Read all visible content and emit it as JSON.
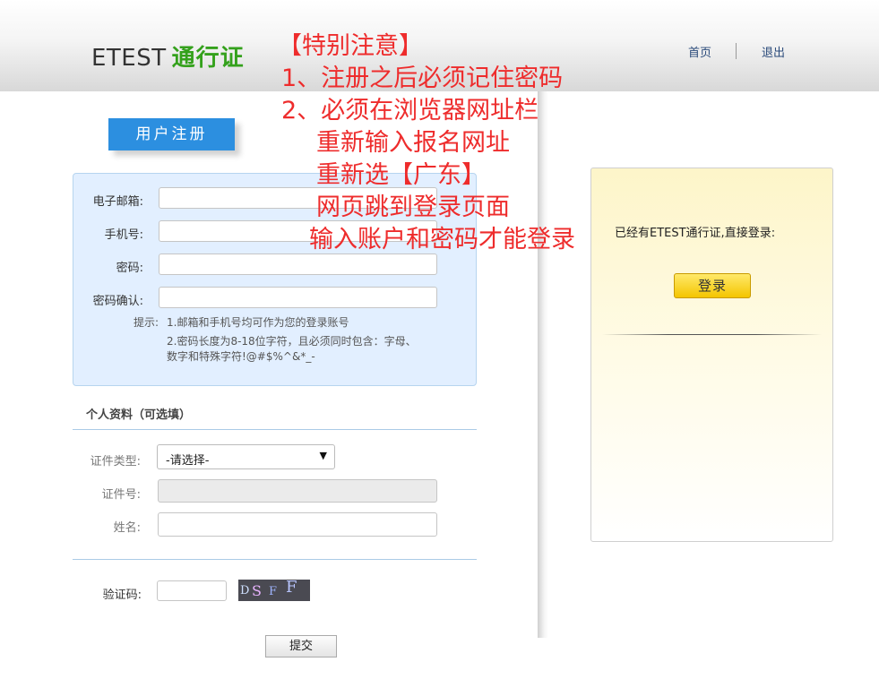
{
  "header": {
    "brand_name": "ETEST",
    "brand_suffix": "通行证",
    "nav_home": "首页",
    "nav_logout": "退出"
  },
  "notice": {
    "lines": [
      "【特别注意】",
      "1、注册之后必须记住密码",
      "2、必须在浏览器网址栏",
      "重新输入报名网址",
      "重新选【广东】",
      "网页跳到登录页面",
      "输入账户和密码才能登录"
    ],
    "color": "#ee2c2c"
  },
  "register": {
    "tab_label": "用户注册",
    "email_label": "电子邮箱:",
    "email_value": "",
    "phone_label": "手机号:",
    "phone_value": "",
    "password_label": "密码:",
    "password_value": "",
    "confirm_label": "密码确认:",
    "confirm_value": "",
    "hint_prefix": "提示:",
    "hint_1": "1.邮箱和手机号均可作为您的登录账号",
    "hint_2a": "2.密码长度为8-18位字符，且必须同时包含：字母、",
    "hint_2b": "数字和特殊字符!@#$%^&*_-"
  },
  "personal": {
    "title": "个人资料（可选填）",
    "id_type_label": "证件类型:",
    "id_type_selected": "-请选择-",
    "id_number_label": "证件号:",
    "id_number_value": "",
    "name_label": "姓名:",
    "name_value": ""
  },
  "captcha": {
    "label": "验证码:",
    "value": "",
    "image_text": "DSFF"
  },
  "submit_label": "提交",
  "login": {
    "prompt": "已经有ETEST通行证,直接登录:",
    "button_label": "登录"
  },
  "colors": {
    "accent_blue": "#2c8fe0",
    "brand_green": "#34a11c",
    "login_yellow": "#f4c500"
  }
}
